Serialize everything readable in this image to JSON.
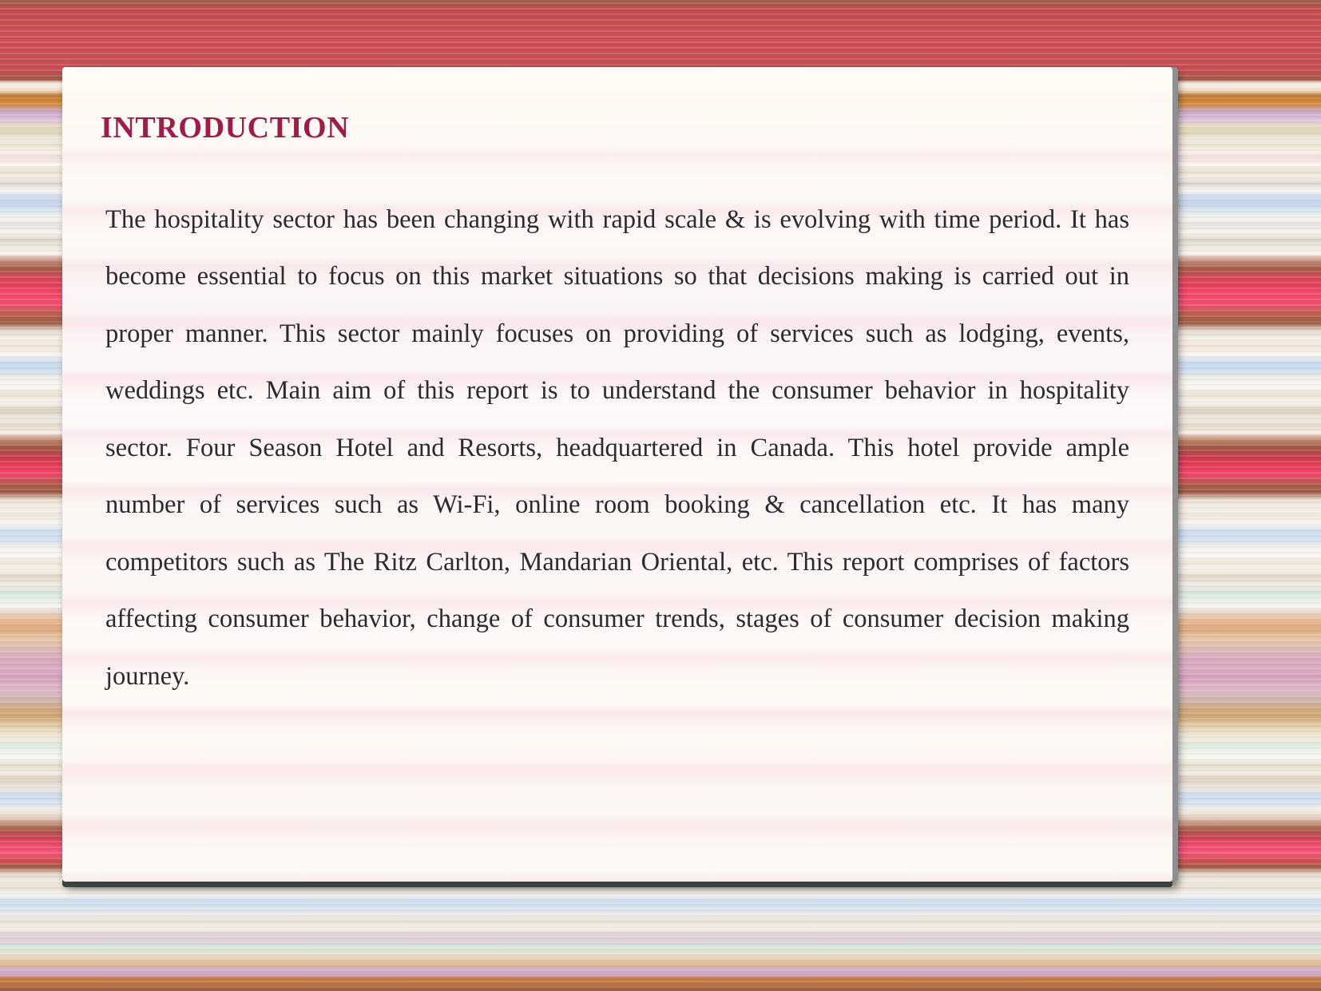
{
  "slide": {
    "title": "INTRODUCTION",
    "title_color": "#a01b47",
    "body_color": "#2b2b2b",
    "body": "The hospitality sector has been changing with rapid scale & is evolving with time period. It has become essential to focus on this market situations so that decisions making is carried out in proper manner. This sector mainly focuses on providing of services such as lodging, events, weddings etc. Main aim of this report is to understand the consumer behavior in hospitality sector. Four Season Hotel and Resorts, headquartered in Canada. This hotel provide ample number of services such as Wi-Fi, online room booking & cancellation etc. It has many competitors such as The Ritz Carlton,  Mandarian Oriental, etc.  This report comprises of factors affecting  consumer behavior,  change of consumer trends,  stages of consumer decision making  journey."
  },
  "theme": {
    "background_style": "horizontal-stripes",
    "top_band_color": "#cd4f53",
    "bottom_band_color": "#985c45",
    "stripe_accent_red": "#ef486a",
    "stripe_accent_blue": "#cfdcea",
    "stripe_accent_brown": "#a05c45",
    "card_background": "#fdf9f6",
    "card_shadow_color": "#3c423f"
  }
}
